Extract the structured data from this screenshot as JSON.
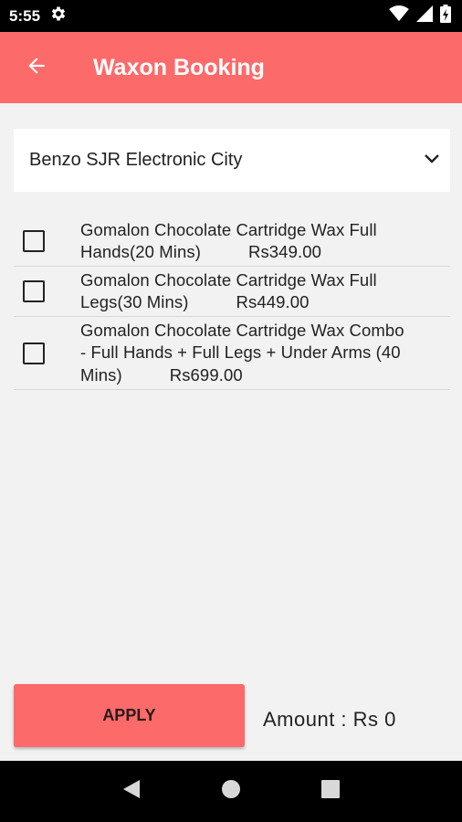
{
  "status_bar": {
    "time": "5:55",
    "icons": [
      "settings-icon",
      "wifi-icon",
      "cell-signal-icon",
      "battery-charging-icon"
    ]
  },
  "app_bar": {
    "title": "Waxon Booking",
    "back_icon": "arrow-back-icon",
    "background": "#fd6a6a"
  },
  "location_spinner": {
    "selected": "Benzo SJR Electronic City",
    "icon": "chevron-down-icon"
  },
  "services": [
    {
      "line1": "Gomalon Chocolate Cartridge Wax Full",
      "name_end": "Hands(20 Mins)",
      "price": "Rs349.00",
      "checked": false
    },
    {
      "line1": "Gomalon Chocolate Cartridge Wax Full",
      "name_end": "Legs(30 Mins)",
      "price": "Rs449.00",
      "checked": false
    },
    {
      "line1": "Gomalon Chocolate Cartridge Wax Combo",
      "line2": "- Full Hands + Full Legs + Under Arms (40",
      "name_end": "Mins)",
      "price": "Rs699.00",
      "checked": false
    }
  ],
  "footer": {
    "apply_label": "APPLY",
    "amount_text": "Amount : Rs 0"
  },
  "nav_bar": {
    "icons": [
      "back-triangle-icon",
      "home-circle-icon",
      "recents-square-icon"
    ]
  }
}
